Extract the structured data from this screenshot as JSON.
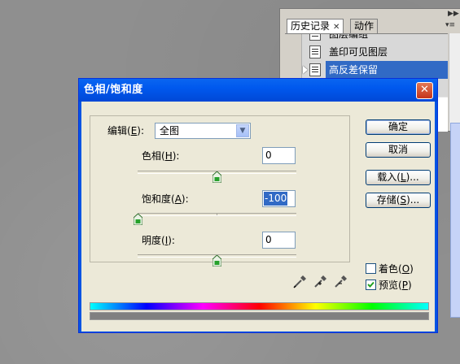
{
  "history_panel": {
    "tabs": [
      {
        "label": "历史记录",
        "active": true
      },
      {
        "label": "动作",
        "active": false
      }
    ],
    "items": [
      {
        "label": "图层编组"
      },
      {
        "label": "盖印可见图层"
      },
      {
        "label": "高反差保留",
        "selected": true
      },
      {
        "label": ""
      }
    ]
  },
  "dialog": {
    "title": "色相/饱和度",
    "close_glyph": "✕",
    "edit": {
      "label_prefix": "编辑(",
      "hotkey": "E",
      "label_suffix": "):",
      "selected": "全图"
    },
    "hue": {
      "label_prefix": "色相(",
      "hotkey": "H",
      "label_suffix": "):",
      "value": "0",
      "level": 0,
      "range": [
        -180,
        180
      ]
    },
    "saturation": {
      "label_prefix": "饱和度(",
      "hotkey": "A",
      "label_suffix": "):",
      "value": "-100",
      "level": -100,
      "range": [
        -100,
        100
      ]
    },
    "lightness": {
      "label_prefix": "明度(",
      "hotkey": "I",
      "label_suffix": "):",
      "value": "0",
      "level": 0,
      "range": [
        -100,
        100
      ]
    },
    "buttons": {
      "ok": "确定",
      "cancel": "取消",
      "load": {
        "prefix": "载入(",
        "hotkey": "L",
        "suffix": ")..."
      },
      "save": {
        "prefix": "存储(",
        "hotkey": "S",
        "suffix": ")..."
      }
    },
    "colorize": {
      "prefix": "着色(",
      "hotkey": "O",
      "suffix": ")",
      "checked": false
    },
    "preview": {
      "prefix": "预览(",
      "hotkey": "P",
      "suffix": ")",
      "checked": true
    }
  },
  "colors": {
    "title_bar": "#0054e3",
    "selection": "#316ac5",
    "dialog_bg": "#ece9d8"
  }
}
